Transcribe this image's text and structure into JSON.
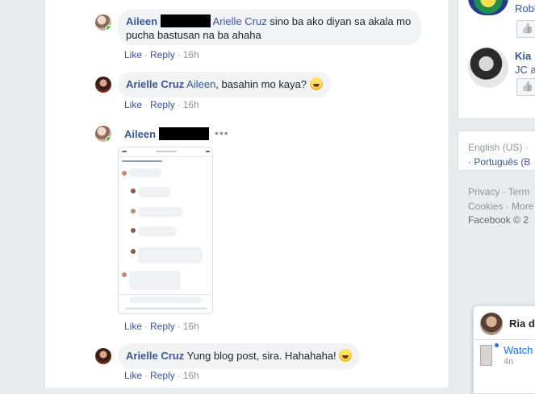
{
  "comments": [
    {
      "author": "Aileen",
      "mention": "Arielle Cruz",
      "text": " sino ba ako diyan sa akala mo pucha bastusan na ba ahaha",
      "like": "Like",
      "reply": "Reply",
      "time": "16h"
    },
    {
      "author": "Arielle Cruz",
      "mention": "Aileen",
      "text": ", basahin mo kaya? ",
      "like": "Like",
      "reply": "Reply",
      "time": "16h"
    },
    {
      "author": "Aileen",
      "like": "Like",
      "reply": "Reply",
      "time": "16h",
      "more": "•••"
    },
    {
      "author": "Arielle Cruz",
      "text": "Yung blog post, sira. Hahahaha! ",
      "like": "Like",
      "reply": "Reply",
      "time": "16h"
    }
  ],
  "right": {
    "friend1": "Robl",
    "friend2": "Kia",
    "friend2_sub": "JC a",
    "lang1": "English (US) ·",
    "lang2": "· Português (B",
    "footer1": "Privacy · Term",
    "footer2": "Cookies · More",
    "footer3": "Facebook © 2",
    "chat_name": "Ria d",
    "chat_action": "Watch",
    "chat_time": "4n"
  }
}
